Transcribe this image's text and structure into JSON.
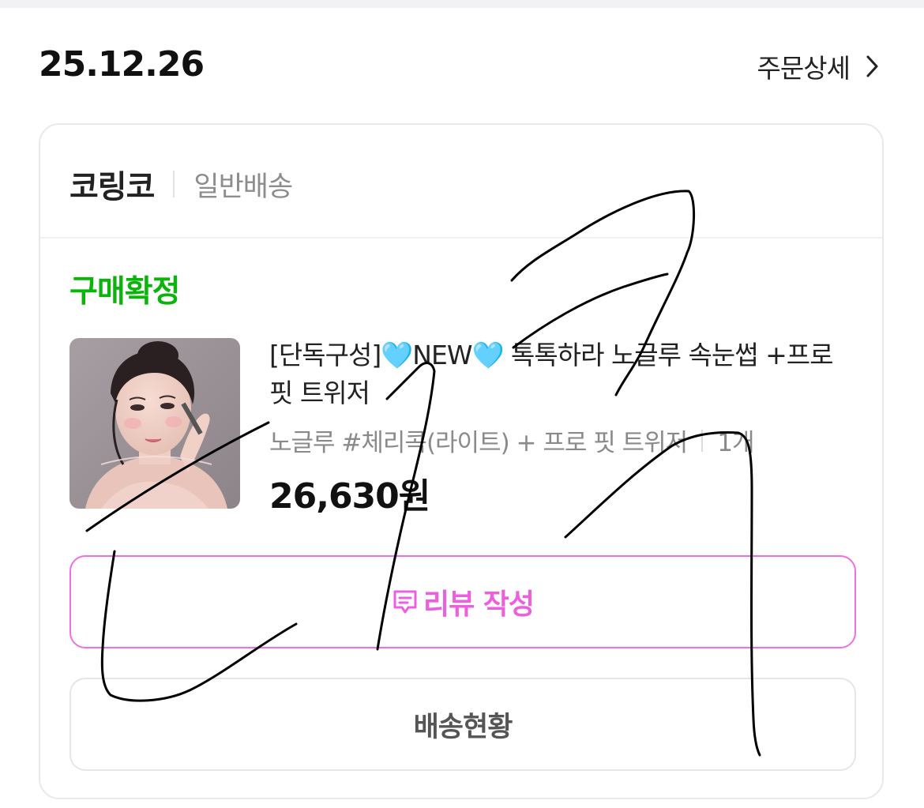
{
  "order": {
    "date": "25.12.26",
    "detail_label": "주문상세",
    "detail_icon": "chevron-right-icon"
  },
  "seller": {
    "name": "코링코",
    "shipping_type": "일반배송"
  },
  "status": {
    "label": "구매확정",
    "color": "#0bb40b"
  },
  "product": {
    "title": "[단독구성]🩵NEW🩵 톡톡하라 노글루 속눈썹 +프로 핏 트위저",
    "option": "노글루 #체리콕(라이트) + 프로 핏 트위저",
    "quantity": "1개",
    "price": "26,630원",
    "image": "product-thumbnail-model-photo"
  },
  "buttons": {
    "review_label": "리뷰 작성",
    "review_icon": "review-comment-icon",
    "review_color": "#ee5fe0",
    "shipping_label": "배송현황"
  }
}
